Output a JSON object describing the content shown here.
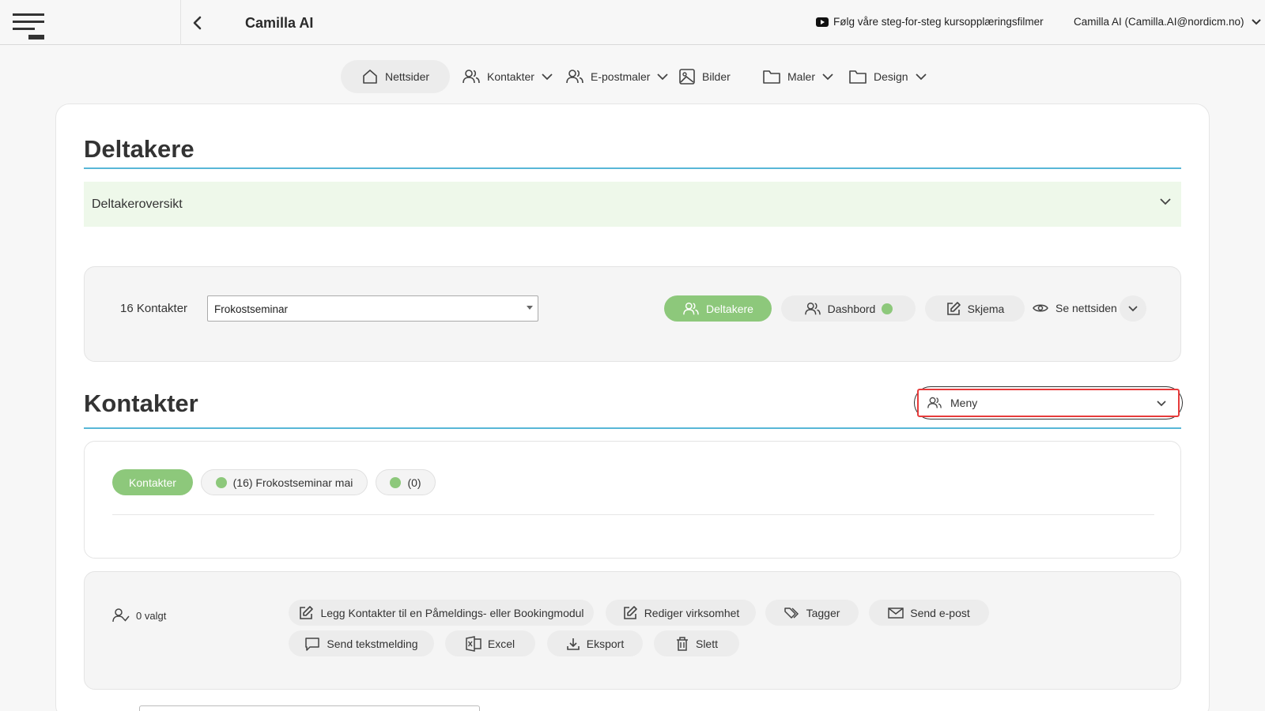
{
  "header": {
    "app_title": "Camilla AI",
    "tutorial_link": "Følg våre steg-for-steg kursopplæringsfilmer",
    "user": "Camilla AI (Camilla.AI@nordicm.no)"
  },
  "nav": {
    "items": [
      {
        "label": "Nettsider",
        "icon": "home-icon",
        "active": true
      },
      {
        "label": "Kontakter",
        "icon": "users-icon",
        "dropdown": true
      },
      {
        "label": "E-postmaler",
        "icon": "users-icon",
        "dropdown": true
      },
      {
        "label": "Bilder",
        "icon": "image-icon"
      },
      {
        "label": "Maler",
        "icon": "folder-icon",
        "dropdown": true
      },
      {
        "label": "Design",
        "icon": "folder-icon",
        "dropdown": true
      }
    ]
  },
  "section1": {
    "title": "Deltakere",
    "accordion_label": "Deltakeroversikt"
  },
  "toolbar": {
    "count": "16 Kontakter",
    "selected_event": "Frokostseminar",
    "buttons": {
      "deltakere": "Deltakere",
      "dashbord": "Dashbord",
      "skjema": "Skjema",
      "se_nettsiden": "Se nettsiden"
    }
  },
  "section2": {
    "title": "Kontakter",
    "menu_label": "Meny"
  },
  "filters": {
    "kontakter": "Kontakter",
    "group1": "(16) Frokostseminar mai",
    "group2": "(0)"
  },
  "actions": {
    "selected": "0 valgt",
    "add_to_module": "Legg Kontakter til en Påmeldings- eller Bookingmodul",
    "edit_company": "Rediger virksomhet",
    "tags": "Tagger",
    "send_email": "Send e-post",
    "send_sms": "Send tekstmelding",
    "excel": "Excel",
    "export": "Eksport",
    "delete": "Slett"
  },
  "colors": {
    "accent_green": "#8dc87b",
    "accent_blue_line": "#58b7d7",
    "highlight_red": "#e63b3b"
  }
}
